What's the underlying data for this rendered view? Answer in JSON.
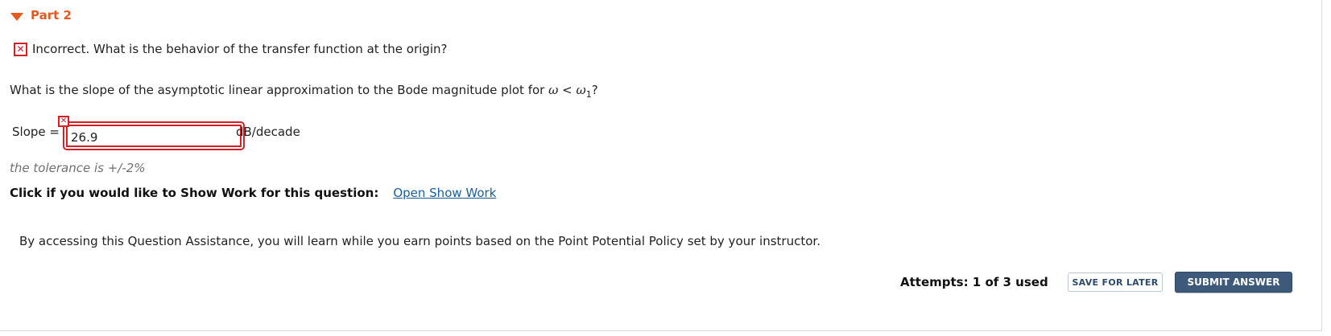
{
  "part": {
    "title": "Part 2",
    "icon": "caret-down-icon"
  },
  "feedback": {
    "icon": "incorrect-x-icon",
    "text": "Incorrect. What is the behavior of the transfer function at the origin?"
  },
  "question": {
    "text_before": "What is the slope of the asymptotic linear approximation to the Bode magnitude plot for",
    "omega": "ω",
    "lt": "<",
    "omega1": "ω",
    "subscript": "1",
    "text_after": "?"
  },
  "answer": {
    "label": "Slope =",
    "value": "26.9",
    "units": "dB/decade",
    "status_icon": "incorrect-x-icon",
    "status_color": "#d42027"
  },
  "tolerance": "the tolerance is +/-2%",
  "show_work": {
    "prompt": "Click if you would like to Show Work for this question:",
    "link": "Open Show Work"
  },
  "assistance_text": "By accessing this Question Assistance, you will learn while you earn points based on the Point Potential Policy set by your instructor.",
  "footer": {
    "attempts": "Attempts: 1 of 3 used",
    "save_label": "SAVE FOR LATER",
    "submit_label": "SUBMIT ANSWER"
  },
  "colors": {
    "accent": "#e8581e",
    "error": "#d42027",
    "link": "#1a5e9e",
    "submit_bg": "#3d5a7a"
  }
}
